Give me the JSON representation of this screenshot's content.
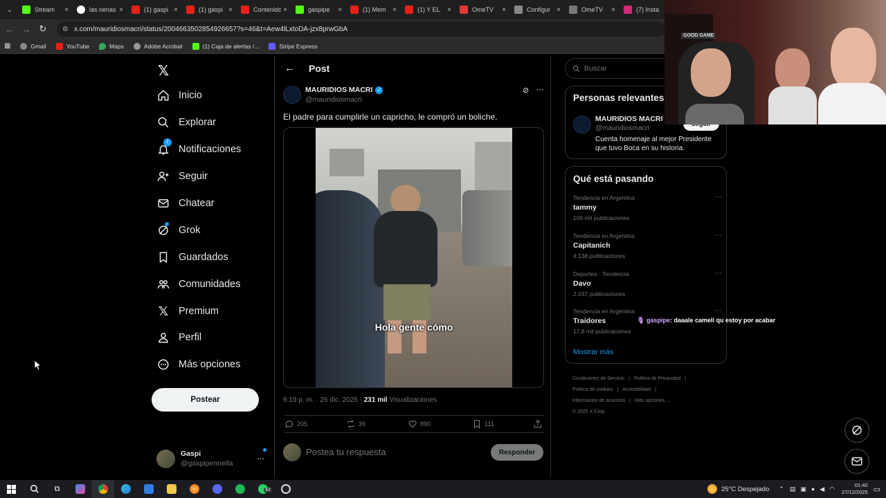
{
  "browser": {
    "tabs": [
      {
        "title": "Stream",
        "favicon": "kick-icon",
        "color": "#1c1c1c"
      },
      {
        "title": "las nenas",
        "favicon": "google-icon",
        "color": "#1c1c1c"
      },
      {
        "title": "(1) gaspi",
        "favicon": "youtube-icon",
        "color": "#1c1c1c"
      },
      {
        "title": "(1) gaspi",
        "favicon": "youtube-icon",
        "color": "#1c1c1c"
      },
      {
        "title": "Contenido",
        "favicon": "youtube-icon",
        "color": "#1c1c1c"
      },
      {
        "title": "gaspipe",
        "favicon": "kick-icon",
        "color": "#1c1c1c"
      },
      {
        "title": "(1) Mem",
        "favicon": "youtube-icon",
        "color": "#1c1c1c"
      },
      {
        "title": "(1) Y EL",
        "favicon": "youtube-icon",
        "color": "#1c1c1c"
      },
      {
        "title": "OmeTV",
        "favicon": "ometv-icon",
        "color": "#1c1c1c"
      },
      {
        "title": "Configur",
        "favicon": "gear-icon",
        "color": "#1c1c1c"
      },
      {
        "title": "OmeTV",
        "favicon": "globe-icon",
        "color": "#1c1c1c"
      },
      {
        "title": "(7) Insta",
        "favicon": "instagram-icon",
        "color": "#1c1c1c"
      }
    ],
    "url": "x.com/mauridiosmacri/status/2004663502854926657?s=46&t=Aew4lLxtoDA-jzx8prwGbA",
    "bookmarks": [
      "Gmail",
      "YouTube",
      "Maps",
      "Adobe Acrobat",
      "(1) Caja de alertas /...",
      "Stripe Express"
    ]
  },
  "sidebar": {
    "items": [
      "Inicio",
      "Explorar",
      "Notificaciones",
      "Seguir",
      "Chatear",
      "Grok",
      "Guardados",
      "Comunidades",
      "Premium",
      "Perfil",
      "Más opciones"
    ],
    "notifications_badge": "1",
    "post_button": "Postear",
    "profile_name": "Gaspi",
    "profile_handle": "@gaspipennella",
    "profile_more": "..."
  },
  "post": {
    "header": "Post",
    "author_name": "MAURIDIOS MACRI",
    "author_handle": "@mauridiosmacri",
    "text": "El padre para cumplirle un capricho, le compró un boliche.",
    "caption": "Hola gente cómo",
    "timestamp": "6:19 p. m. · 26 dic. 2025 · ",
    "views_count": "231 mil",
    "views_label": " Visualizaciones",
    "replies": "205",
    "reposts": "39",
    "likes": "890",
    "bookmarks": "111",
    "reply_placeholder": "Postea tu respuesta",
    "reply_button": "Responder"
  },
  "right": {
    "search_placeholder": "Buscar",
    "relevant_title": "Personas relevantes",
    "relevant_name": "MAURIDIOS MACRI",
    "relevant_handle": "@mauridiosmacri",
    "relevant_bio": "Cuenta homenaje al mejor Presidente que tuvo Boca en su historia.",
    "follow_button": "Seguir",
    "trends_title": "Qué está pasando",
    "trends": [
      {
        "category": "Tendencia en Argentina",
        "name": "tammy",
        "count": "106 mil publicaciones"
      },
      {
        "category": "Tendencia en Argentina",
        "name": "Capitanich",
        "count": "4.138 publicaciones"
      },
      {
        "category": "Deportes · Tendencia",
        "name": "Davo",
        "count": "2.037 publicaciones"
      },
      {
        "category": "Tendencia en Argentina",
        "name": "Traidores",
        "count": "17,8 mil publicaciones"
      }
    ],
    "show_more": "Mostrar más",
    "footer": [
      "Condiciones de Servicio",
      "Política de Privacidad",
      "Política de cookies",
      "Accesibilidad",
      "Información de anuncios",
      "Más opciones ...",
      "© 2025 X Corp."
    ]
  },
  "overlay": {
    "chat_user": "gaspipe",
    "chat_message": ": daaale cameli qu estoy por acabar",
    "webcam_sign": "GOOD GAME"
  },
  "taskbar": {
    "weather": "25°C  Despejado",
    "time": "01:40",
    "date": "27/12/2025",
    "whatsapp_badge": "42"
  },
  "colors": {
    "accent": "#1d9bf0",
    "background": "#000000",
    "border": "#2f3336",
    "muted": "#71767b"
  }
}
